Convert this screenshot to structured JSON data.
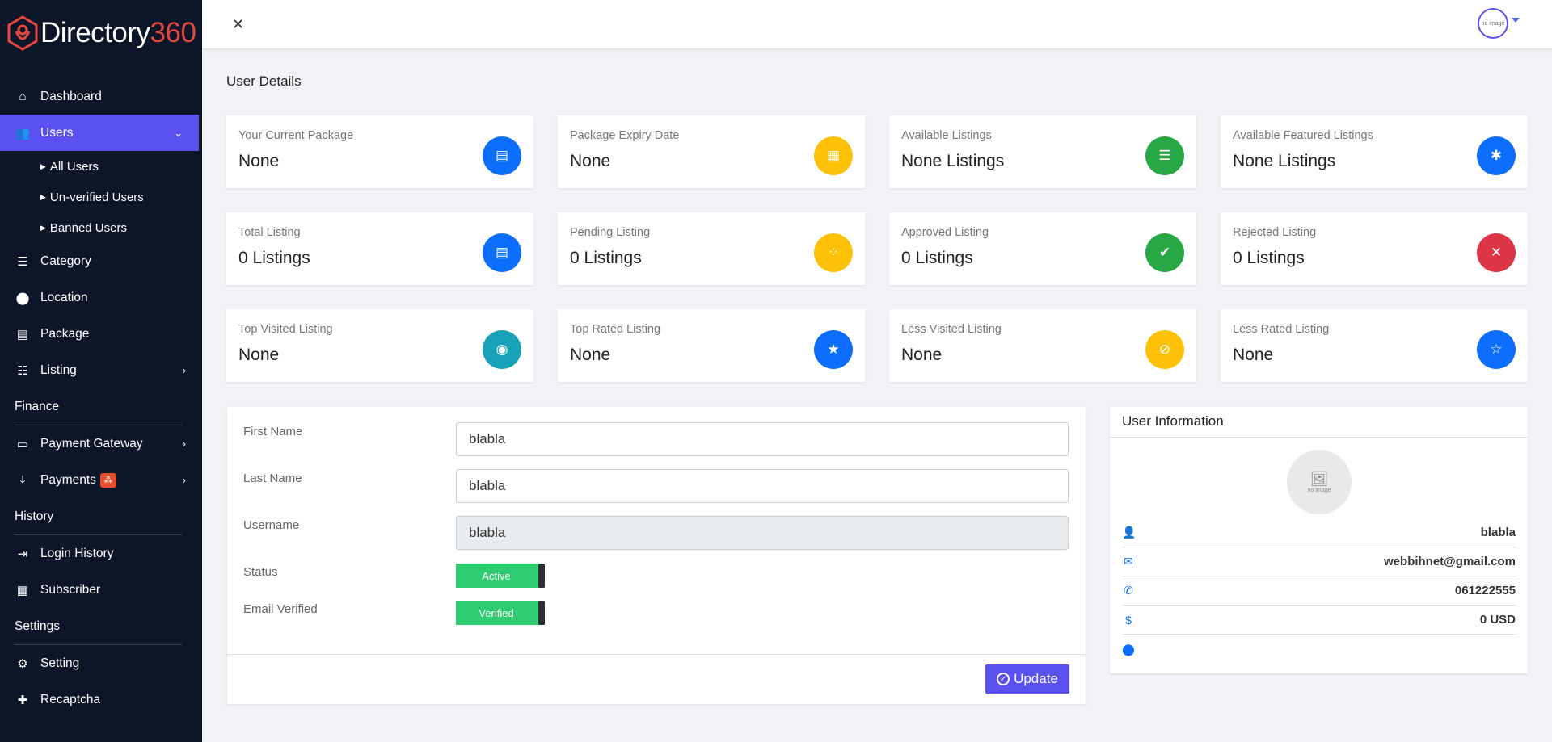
{
  "brand": {
    "name_part1": "Directory",
    "name_part2": "360"
  },
  "header": {
    "avatar_text": "no image"
  },
  "sidebar": {
    "items": [
      {
        "label": "Dashboard"
      },
      {
        "label": "Users"
      },
      {
        "label": "Category"
      },
      {
        "label": "Location"
      },
      {
        "label": "Package"
      },
      {
        "label": "Listing"
      },
      {
        "label": "Payment Gateway"
      },
      {
        "label": "Payments"
      },
      {
        "label": "Login History"
      },
      {
        "label": "Subscriber"
      },
      {
        "label": "Setting"
      },
      {
        "label": "Recaptcha"
      }
    ],
    "user_subitems": [
      {
        "label": "All Users"
      },
      {
        "label": "Un-verified Users"
      },
      {
        "label": "Banned Users"
      }
    ],
    "sections": [
      "Finance",
      "History",
      "Settings"
    ]
  },
  "page_title": "User Details",
  "stats": [
    {
      "label": "Your Current Package",
      "value": "None",
      "icon": "list-alt-icon"
    },
    {
      "label": "Package Expiry Date",
      "value": "None",
      "icon": "calendar-icon"
    },
    {
      "label": "Available Listings",
      "value": "None Listings",
      "icon": "list-icon"
    },
    {
      "label": "Available Featured Listings",
      "value": "None Listings",
      "icon": "asterisk-icon"
    },
    {
      "label": "Total Listing",
      "value": "0 Listings",
      "icon": "list-alt-icon"
    },
    {
      "label": "Pending Listing",
      "value": "0 Listings",
      "icon": "spinner-icon"
    },
    {
      "label": "Approved Listing",
      "value": "0 Listings",
      "icon": "check-icon"
    },
    {
      "label": "Rejected Listing",
      "value": "0 Listings",
      "icon": "times-icon"
    },
    {
      "label": "Top Visited Listing",
      "value": "None",
      "icon": "eye-icon"
    },
    {
      "label": "Top Rated Listing",
      "value": "None",
      "icon": "star-icon"
    },
    {
      "label": "Less Visited Listing",
      "value": "None",
      "icon": "eye-slash-icon"
    },
    {
      "label": "Less Rated Listing",
      "value": "None",
      "icon": "star-outline-icon"
    }
  ],
  "form": {
    "first_name_label": "First Name",
    "first_name": "blabla",
    "last_name_label": "Last Name",
    "last_name": "blabla",
    "username_label": "Username",
    "username": "blabla",
    "status_label": "Status",
    "status": "Active",
    "email_verified_label": "Email Verified",
    "email_verified": "Verified",
    "update_label": "Update"
  },
  "user_info": {
    "title": "User Information",
    "no_image_text": "no image",
    "name": "blabla",
    "email": "webbihnet@gmail.com",
    "phone": "061222555",
    "balance": "0 USD",
    "location": ""
  },
  "colors": {
    "sidebar_bg": "#0b1629",
    "accent": "#5a52f0",
    "blue": "#0d6efd",
    "yellow": "#ffc107",
    "green": "#28a745",
    "red": "#dc3545",
    "teal": "#17a2b8",
    "toggle_green": "#2ecc71"
  }
}
